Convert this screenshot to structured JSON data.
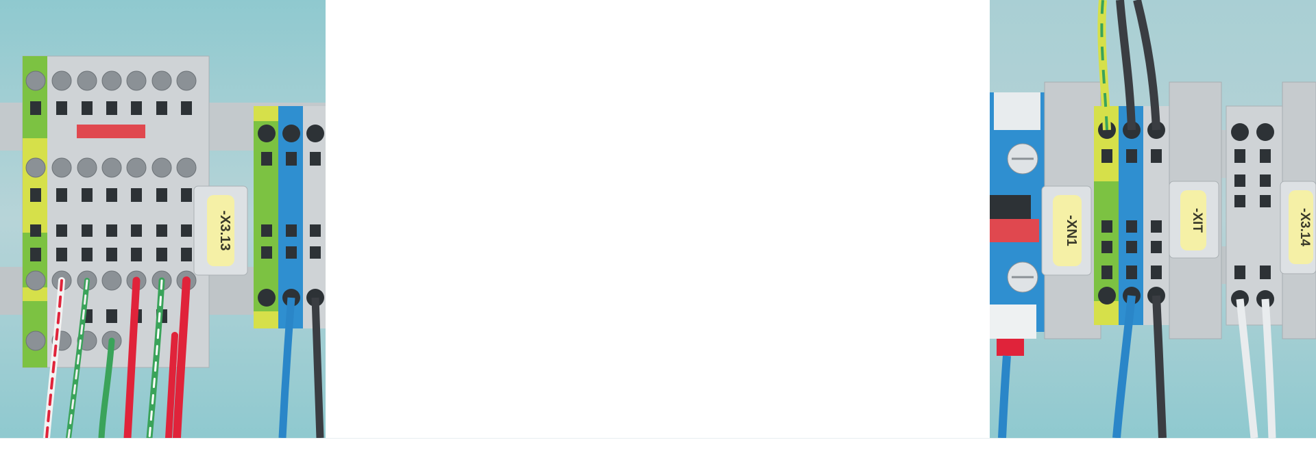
{
  "hero": {
    "left_image": {
      "description_icon": "terminal-block-photo",
      "marker_label": "-X3.13"
    },
    "right_image": {
      "description_icon": "terminal-block-photo",
      "marker_labels": [
        "-XN1",
        "-XIT",
        "-X3.14"
      ]
    }
  },
  "colors": {
    "background_teal": "#8fc9cf",
    "terminal_grey": "#c9cdd0",
    "terminal_green": "#7cc242",
    "terminal_yellow": "#d6e04a",
    "terminal_blue": "#2f8fd0",
    "marker_yellow": "#f5f0a6",
    "wire_red": "#e0233a",
    "wire_green": "#3aa35a",
    "wire_blue": "#2a86c8",
    "wire_black": "#3a3d42"
  }
}
